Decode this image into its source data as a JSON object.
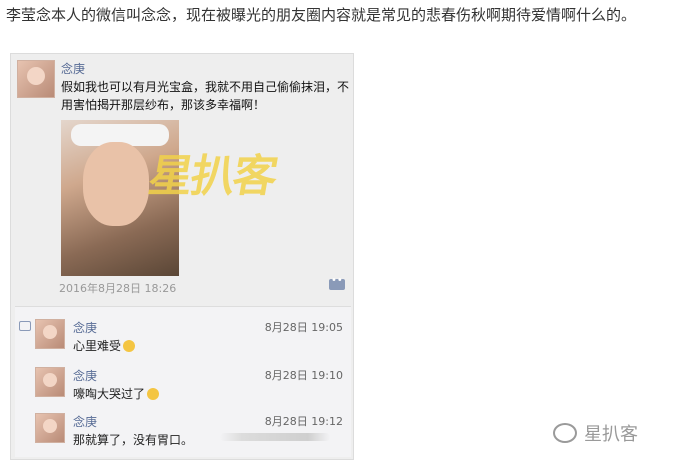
{
  "article": {
    "text": "李莹念本人的微信叫念念，现在被曝光的朋友圈内容就是常见的悲春伤秋啊期待爱情啊什么的。"
  },
  "post": {
    "author": "念庚",
    "text": "假如我也可以有月光宝盒，我就不用自己偷偷抹泪，不用害怕揭开那层纱布，那该多幸福啊！",
    "watermark": "星扒客",
    "timestamp": "2016年8月28日 18:26"
  },
  "comments": [
    {
      "author": "念庚",
      "text": "心里难受",
      "time": "8月28日 19:05"
    },
    {
      "author": "念庚",
      "text": "嚎啕大哭过了",
      "time": "8月28日 19:10"
    },
    {
      "author": "念庚",
      "text": "那就算了，没有胃口。",
      "time": "8月28日 19:12"
    }
  ],
  "brand": {
    "name": "星扒客"
  },
  "colors": {
    "name_link": "#576b95",
    "background": "#eeeeee"
  }
}
